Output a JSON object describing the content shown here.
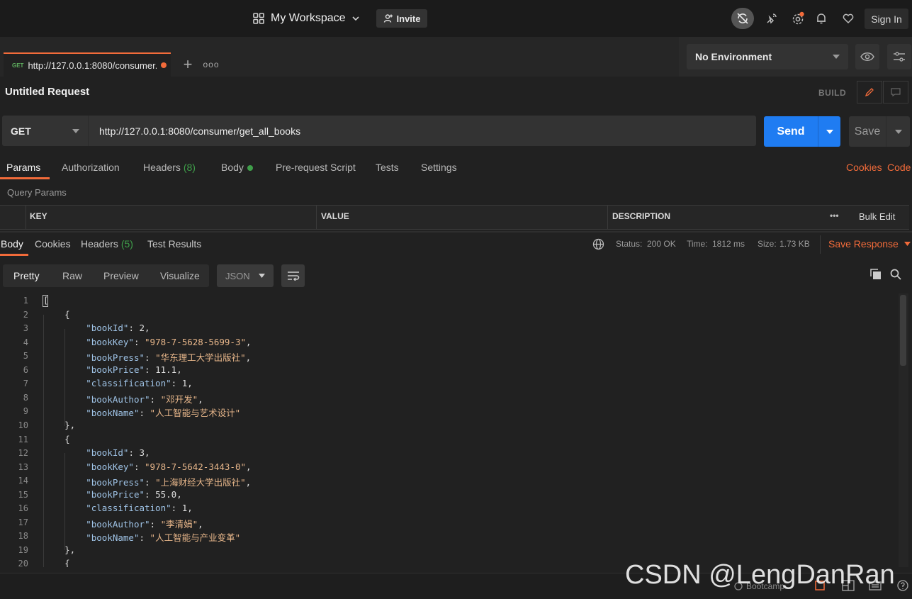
{
  "header": {
    "workspace": "My Workspace",
    "invite": "Invite",
    "sign_in": "Sign In"
  },
  "tabs": [
    {
      "method": "GET",
      "url": "http://127.0.0.1:8080/consumer..."
    }
  ],
  "environment": {
    "selected": "No Environment"
  },
  "request": {
    "title": "Untitled Request",
    "mode": "BUILD",
    "method": "GET",
    "url": "http://127.0.0.1:8080/consumer/get_all_books",
    "send": "Send",
    "save": "Save"
  },
  "request_tabs": {
    "params": "Params",
    "authorization": "Authorization",
    "headers": "Headers",
    "headers_count": "(8)",
    "body": "Body",
    "prerequest": "Pre-request Script",
    "tests": "Tests",
    "settings": "Settings",
    "cookies": "Cookies",
    "code": "Code"
  },
  "query_params": {
    "title": "Query Params",
    "columns": [
      "KEY",
      "VALUE",
      "DESCRIPTION"
    ],
    "more": "•••",
    "bulk_edit": "Bulk Edit"
  },
  "response": {
    "tabs": {
      "body": "Body",
      "cookies": "Cookies",
      "headers": "Headers",
      "headers_count": "(5)",
      "test_results": "Test Results"
    },
    "status_label": "Status:",
    "status": "200 OK",
    "time_label": "Time:",
    "time": "1812 ms",
    "size_label": "Size:",
    "size": "1.73 KB",
    "save_response": "Save Response",
    "formats": [
      "Pretty",
      "Raw",
      "Preview",
      "Visualize"
    ],
    "language": "JSON"
  },
  "code_lines": [
    {
      "n": "1",
      "t": "["
    },
    {
      "n": "2",
      "t": "    {"
    },
    {
      "n": "3",
      "indent": 8,
      "key": "bookId",
      "num": "2"
    },
    {
      "n": "4",
      "indent": 8,
      "key": "bookKey",
      "str": "978-7-5628-5699-3"
    },
    {
      "n": "5",
      "indent": 8,
      "key": "bookPress",
      "str": "华东理工大学出版社"
    },
    {
      "n": "6",
      "indent": 8,
      "key": "bookPrice",
      "num": "11.1"
    },
    {
      "n": "7",
      "indent": 8,
      "key": "classification",
      "num": "1"
    },
    {
      "n": "8",
      "indent": 8,
      "key": "bookAuthor",
      "str": "邓开发"
    },
    {
      "n": "9",
      "indent": 8,
      "key": "bookName",
      "str": "人工智能与艺术设计",
      "last": true
    },
    {
      "n": "10",
      "t": "    },"
    },
    {
      "n": "11",
      "t": "    {"
    },
    {
      "n": "12",
      "indent": 8,
      "key": "bookId",
      "num": "3"
    },
    {
      "n": "13",
      "indent": 8,
      "key": "bookKey",
      "str": "978-7-5642-3443-0"
    },
    {
      "n": "14",
      "indent": 8,
      "key": "bookPress",
      "str": "上海财经大学出版社"
    },
    {
      "n": "15",
      "indent": 8,
      "key": "bookPrice",
      "num": "55.0"
    },
    {
      "n": "16",
      "indent": 8,
      "key": "classification",
      "num": "1"
    },
    {
      "n": "17",
      "indent": 8,
      "key": "bookAuthor",
      "str": "李清娟"
    },
    {
      "n": "18",
      "indent": 8,
      "key": "bookName",
      "str": "人工智能与产业变革",
      "last": true
    },
    {
      "n": "19",
      "t": "    },"
    },
    {
      "n": "20",
      "t": "    {"
    }
  ],
  "footer": {
    "bootcamp": "Bootcamp"
  },
  "watermark": "CSDN @LengDanRan"
}
